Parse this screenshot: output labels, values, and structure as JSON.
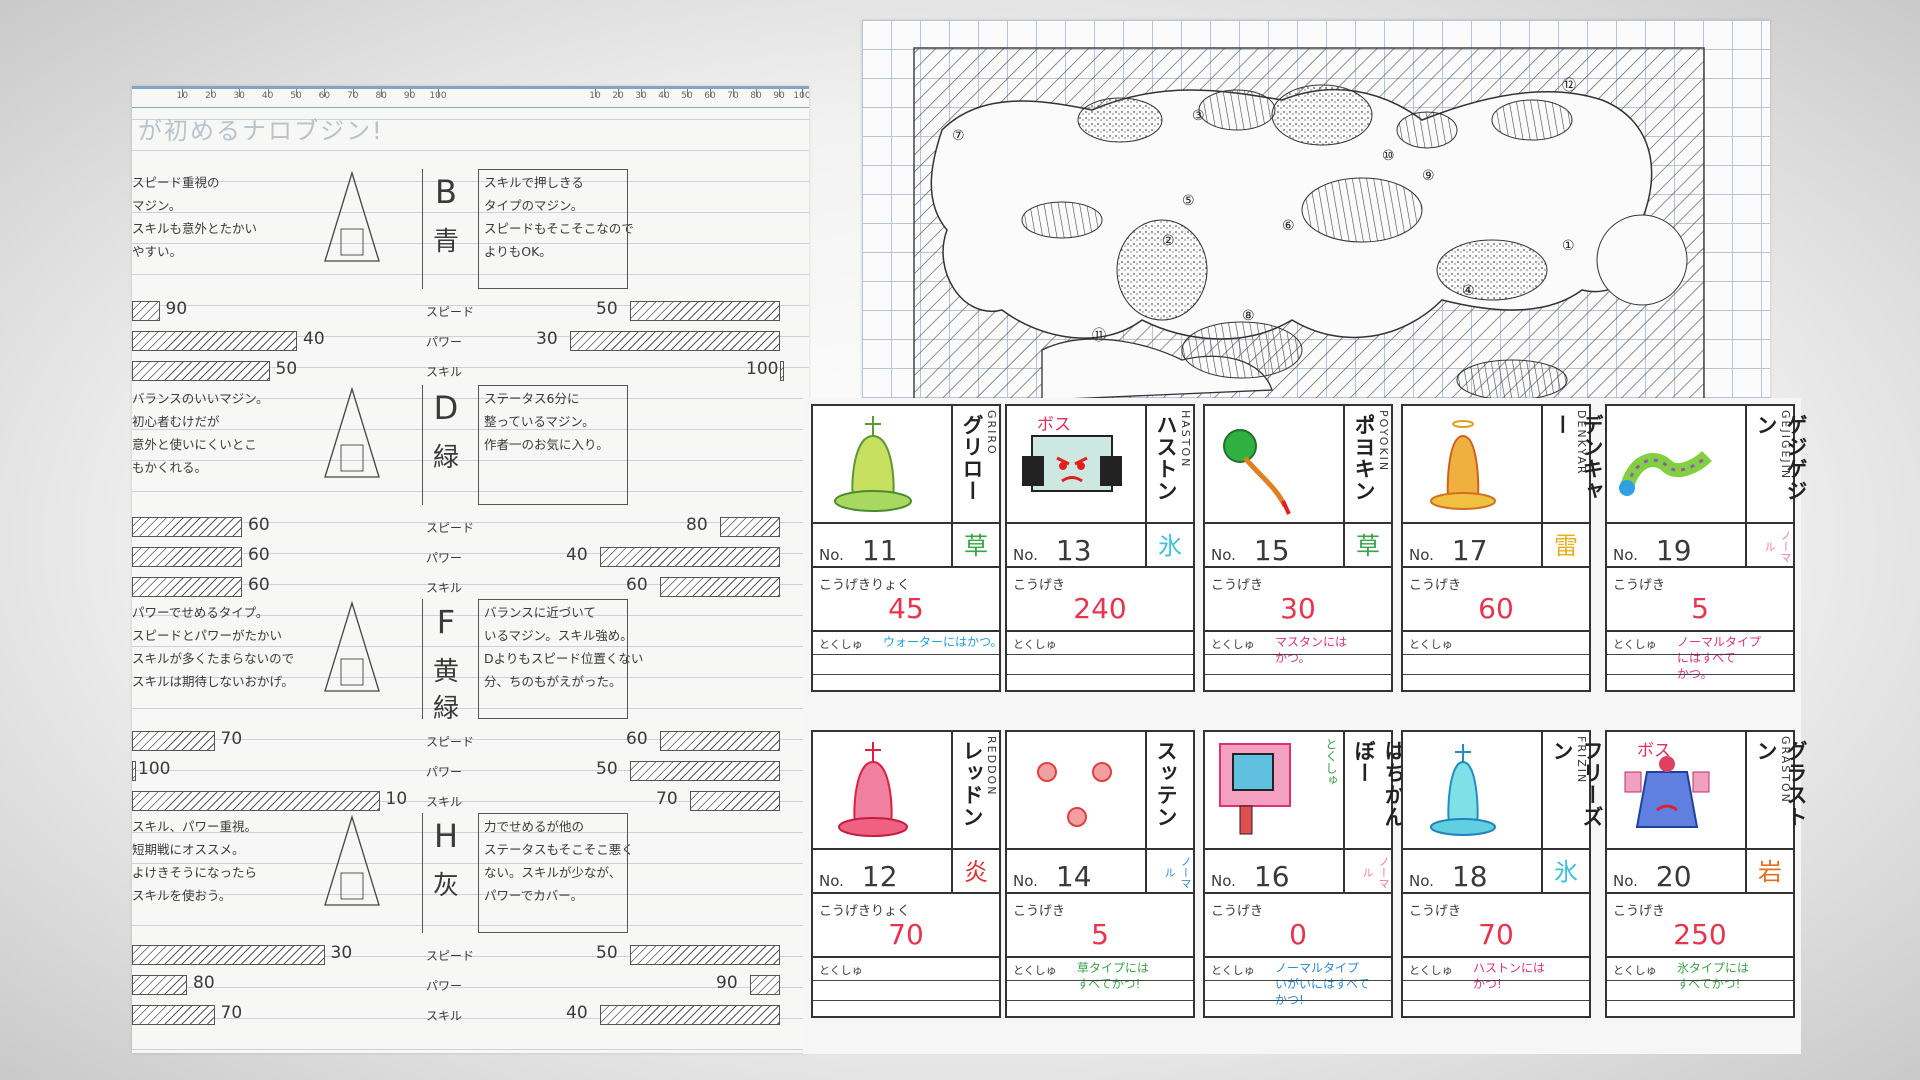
{
  "notebook": {
    "title": "が初めるナロブ゙ジン!",
    "ruler": [
      "10",
      "20",
      "30",
      "40",
      "50",
      "60",
      "70",
      "80",
      "90",
      "100"
    ],
    "label_speed": "スピード",
    "label_power": "パワー",
    "label_skill": "スキル",
    "characters": [
      {
        "desc": "スピード重視の\nマジン。\nスキルも意外とたかい\nやすい。",
        "letter": "B",
        "color": "青",
        "desc2": "スキルで押しきる\nタイプのマジン。\nスピードもそこそこなので\nよりもOK。",
        "left": {
          "speed": 90,
          "power": 40,
          "skill": 50
        },
        "right": {
          "speed": 50,
          "power": 30,
          "skill": 100
        }
      },
      {
        "desc": "バランスのいいマジン。\n初心者むけだが\n意外と使いにくいとこ\nもかくれる。",
        "letter": "D",
        "color": "緑",
        "desc2": "ステータス6分に\n整っているマジン。\n作者一のお気に入り。",
        "left": {
          "speed": 60,
          "power": 60,
          "skill": 60
        },
        "right": {
          "speed": 80,
          "power": 40,
          "skill": 60
        }
      },
      {
        "desc": "パワーでせめるタイプ。\nスピードとパワーがたかい\nスキルが多くたまらないので\nスキルは期待しないおかげ。",
        "letter": "F",
        "color": "黄緑",
        "desc2": "バランスに近づいて\nいるマジン。スキル強め。\nDよりもスピード位置くない\n分、ちのもがえがった。",
        "left": {
          "speed": 70,
          "power": 100,
          "skill": 10
        },
        "right": {
          "speed": 60,
          "power": 50,
          "skill": 70
        }
      },
      {
        "desc": "スキル、パワー重視。\n短期戦にオススメ。\nよけきそうになったら\nスキルを使おう。",
        "letter": "H",
        "color": "灰",
        "desc2": "力でせめるが他の\nステータスもそこそこ悪く\nない。スキルが少なが、\nパワーでカバー。",
        "left": {
          "speed": 30,
          "power": 80,
          "skill": 70
        },
        "right": {
          "speed": 50,
          "power": 90,
          "skill": 40
        }
      }
    ]
  },
  "map": {
    "markers": [
      "①",
      "②",
      "③",
      "④",
      "⑤",
      "⑥",
      "⑦",
      "⑧",
      "⑨",
      "⑩",
      "⑪",
      "⑫"
    ]
  },
  "cards": {
    "no_label": "No.",
    "attack_label": "こうげき",
    "attack_label_long": "こうげきりょく",
    "special_label": "とくしゅ",
    "boss_label": "ボス",
    "list": [
      {
        "name": "グリロー",
        "romaji": "GRIRO",
        "no": "11",
        "type": "草",
        "type_color": "#3aa24a",
        "attack_label": "こうげきりょく",
        "attack": "45",
        "special": "ウォーターにはかつ。",
        "special_color": "#1aa0d8",
        "boss": false,
        "art": "alien-green"
      },
      {
        "name": "ハストン",
        "romaji": "HASTON",
        "no": "13",
        "type": "氷",
        "type_color": "#3ec3d8",
        "attack_label": "こうげき",
        "attack": "240",
        "special": "",
        "special_color": "#333",
        "boss": true,
        "art": "robot-face"
      },
      {
        "name": "ポヨキン",
        "romaji": "POYOKIN",
        "no": "15",
        "type": "草",
        "type_color": "#3aa24a",
        "attack_label": "こうげき",
        "attack": "30",
        "special": "マスタンには\nかつ。",
        "special_color": "#e0307a",
        "boss": false,
        "art": "plant"
      },
      {
        "name": "デンキャー",
        "romaji": "DENKYAR",
        "no": "17",
        "type": "雷",
        "type_color": "#e8b020",
        "attack_label": "こうげき",
        "attack": "60",
        "special": "",
        "special_color": "#333",
        "boss": false,
        "art": "alien-orange"
      },
      {
        "name": "ゲジゲジン",
        "romaji": "GEJIGEJIN",
        "no": "19",
        "type": "ノーマル",
        "type_color": "#f07aa8",
        "attack_label": "こうげき",
        "attack": "5",
        "special": "ノーマルタイプ\nにはすべて\nかつ。",
        "special_color": "#e0307a",
        "boss": false,
        "art": "worm"
      },
      {
        "name": "レッドン",
        "romaji": "REDDON",
        "no": "12",
        "type": "炎",
        "type_color": "#e03030",
        "attack_label": "こうげきりょく",
        "attack": "70",
        "special": "",
        "special_color": "#333",
        "boss": false,
        "art": "alien-red"
      },
      {
        "name": "スッテン",
        "romaji": "",
        "no": "14",
        "type": "ノーマル",
        "type_color": "#3a8ad8",
        "attack_label": "こうげき",
        "attack": "5",
        "special": "草タイプには\nすべてかつ!",
        "special_color": "#3aa24a",
        "boss": false,
        "art": "dots"
      },
      {
        "name": "はちかんぼー",
        "romaji": "",
        "no": "16",
        "type": "ノーマル",
        "type_color": "#f07aa8",
        "attack_label": "こうげき",
        "attack": "0",
        "special": "ノーマルタイプ\nいがいにはすべて\nかつ!",
        "special_color": "#2a8ad8",
        "boss": false,
        "art": "tv",
        "side_note": "とくしゅ",
        "side_note_color": "#3aa24a"
      },
      {
        "name": "フリーズン",
        "romaji": "FRIZIN",
        "no": "18",
        "type": "氷",
        "type_color": "#3ec3d8",
        "attack_label": "こうげき",
        "attack": "70",
        "special": "ハストンには\nかつ!",
        "special_color": "#e0307a",
        "boss": false,
        "art": "alien-cyan"
      },
      {
        "name": "グラストン",
        "romaji": "GRASTON",
        "no": "20",
        "type": "岩",
        "type_color": "#e07020",
        "attack_label": "こうげき",
        "attack": "250",
        "special": "氷タイプには\nすべてかつ!",
        "special_color": "#3aa24a",
        "boss": true,
        "art": "golem"
      }
    ]
  }
}
